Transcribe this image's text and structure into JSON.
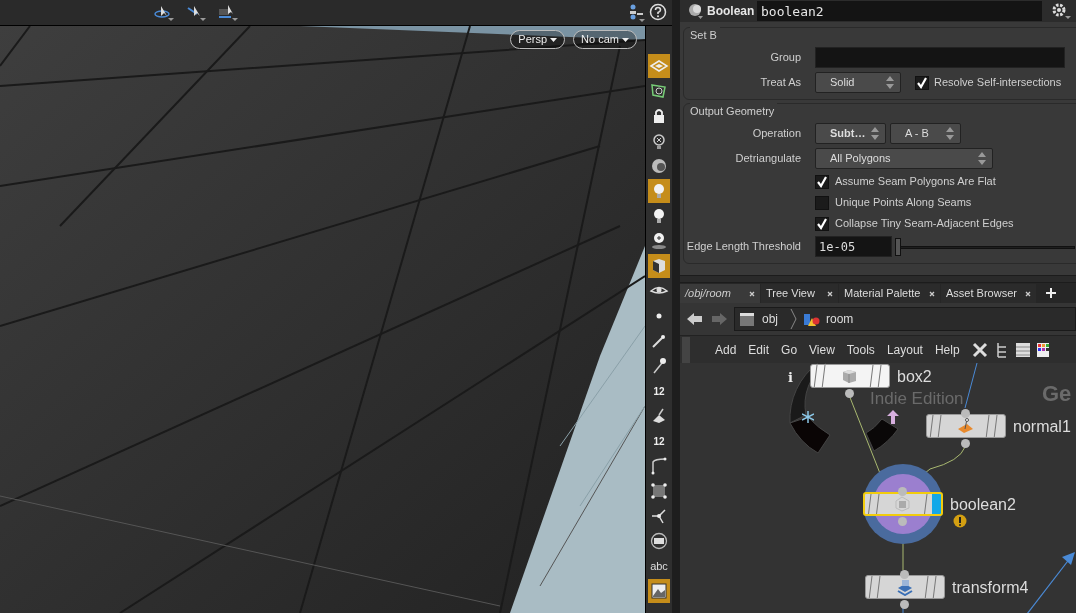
{
  "viewport": {
    "camera_menus": [
      "Persp",
      "No cam"
    ]
  },
  "side_toolbar": [
    {
      "kind": "display",
      "on": true
    },
    {
      "kind": "wire",
      "on": false
    },
    {
      "kind": "lock",
      "on": false
    },
    {
      "kind": "ghost",
      "on": false
    },
    {
      "kind": "sphere",
      "on": false
    },
    {
      "kind": "bulb",
      "on": true
    },
    {
      "kind": "bulb",
      "on": false
    },
    {
      "kind": "light",
      "on": false
    },
    {
      "kind": "shade",
      "on": true
    },
    {
      "kind": "eye",
      "on": false
    },
    {
      "kind": "dot",
      "on": false
    },
    {
      "kind": "wand",
      "on": false
    },
    {
      "kind": "pin",
      "on": false
    },
    {
      "kind": "number",
      "label": "12",
      "on": false
    },
    {
      "kind": "broom",
      "on": false
    },
    {
      "kind": "number",
      "label": "12",
      "on": false
    },
    {
      "kind": "corner",
      "on": false
    },
    {
      "kind": "square",
      "on": false
    },
    {
      "kind": "axes",
      "on": false
    },
    {
      "kind": "circle",
      "on": false
    },
    {
      "kind": "text",
      "label": "abc",
      "on": false
    },
    {
      "kind": "frame",
      "on": true
    }
  ],
  "parameters": {
    "node_type": "Boolean",
    "node_name": "boolean2",
    "groups": [
      {
        "title": "Set B",
        "rows": [
          {
            "kind": "field",
            "label": "Group"
          },
          {
            "kind": "menu",
            "label": "Treat As",
            "value": "Solid",
            "toggle": {
              "label": "Resolve Self-intersections",
              "checked": true
            }
          }
        ]
      },
      {
        "title": "Output Geometry",
        "rows": [
          {
            "kind": "menu_pair",
            "label": "Operation",
            "values": [
              "Subt…",
              "A - B"
            ]
          },
          {
            "kind": "menu_wide",
            "label": "Detriangulate",
            "value": "All Polygons"
          },
          {
            "kind": "checkbox",
            "label": "Assume Seam Polygons Are Flat",
            "checked": true
          },
          {
            "kind": "checkbox",
            "label": "Unique Points Along Seams",
            "checked": false
          },
          {
            "kind": "checkbox",
            "label": "Collapse Tiny Seam-Adjacent Edges",
            "checked": true
          },
          {
            "kind": "slider",
            "label": "Edge Length Threshold",
            "value": "1e-05",
            "level": 0
          }
        ]
      }
    ]
  },
  "network": {
    "tabs": [
      {
        "label": "/obj/room",
        "selected": true
      },
      {
        "label": "Tree View",
        "selected": false
      },
      {
        "label": "Material Palette",
        "selected": false
      },
      {
        "label": "Asset Browser",
        "selected": false
      }
    ],
    "path": [
      "obj",
      "room"
    ],
    "menu": [
      "Add",
      "Edit",
      "Go",
      "View",
      "Tools",
      "Layout",
      "Help"
    ],
    "background_labels": [
      "Indie Edition",
      "Ge"
    ],
    "nodes": [
      {
        "kind": "box",
        "name": "box2",
        "selected": false,
        "warning": false
      },
      {
        "kind": "normal",
        "name": "normal1",
        "selected": false,
        "warning": false
      },
      {
        "kind": "boolean",
        "name": "boolean2",
        "selected": true,
        "warning": true
      },
      {
        "kind": "transform",
        "name": "transform4",
        "selected": false,
        "warning": false
      }
    ],
    "ring_info": "i"
  }
}
